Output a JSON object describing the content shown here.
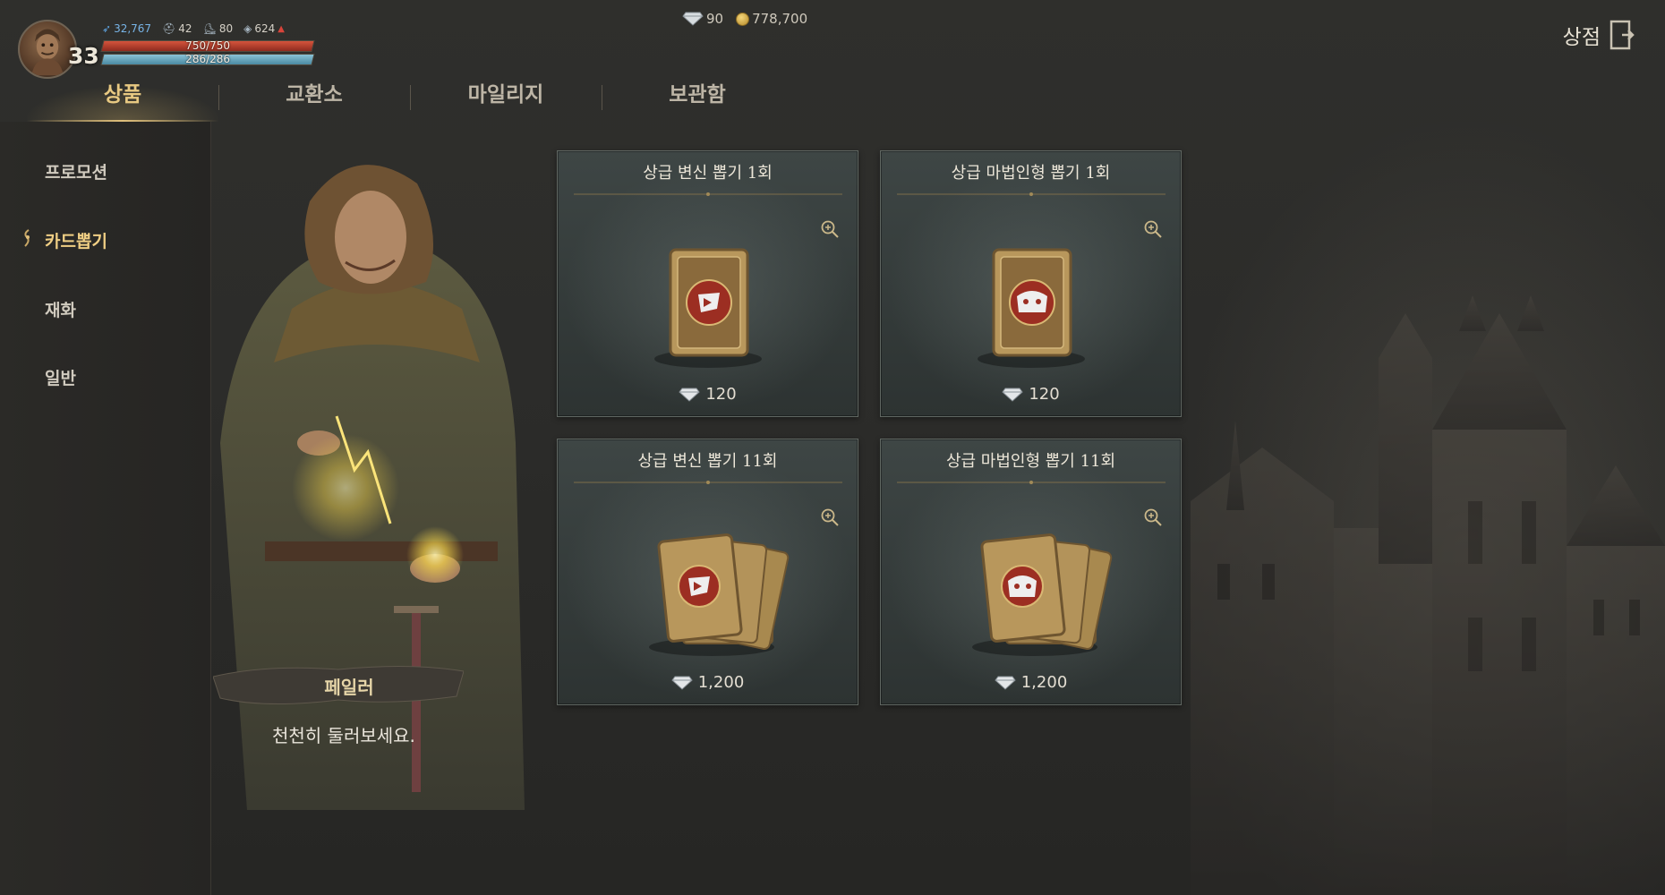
{
  "hud": {
    "level": "33",
    "combat_power": "32,767",
    "stat_2": "42",
    "stat_3": "80",
    "stat_4": "624",
    "hp_text": "750/750",
    "hp_ratio": 1.0,
    "mp_text": "286/286",
    "mp_ratio": 1.0
  },
  "currency": {
    "diamonds": "90",
    "gold": "778,700"
  },
  "shop_title": "상점",
  "tabs": [
    {
      "label": "상품",
      "active": true
    },
    {
      "label": "교환소",
      "active": false
    },
    {
      "label": "마일리지",
      "active": false
    },
    {
      "label": "보관함",
      "active": false
    }
  ],
  "sidebar": {
    "items": [
      {
        "label": "프로모션",
        "active": false
      },
      {
        "label": "카드뽑기",
        "active": true
      },
      {
        "label": "재화",
        "active": false
      },
      {
        "label": "일반",
        "active": false
      }
    ]
  },
  "npc": {
    "name": "페일러",
    "dialog": "천천히 둘러보세요."
  },
  "products": [
    {
      "title": "상급 변신 뽑기 1회",
      "price": "120",
      "art": "transform-card-icon"
    },
    {
      "title": "상급 마법인형 뽑기 1회",
      "price": "120",
      "art": "doll-card-icon"
    },
    {
      "title": "상급 변신 뽑기 11회",
      "price": "1,200",
      "art": "transform-card-stack-icon"
    },
    {
      "title": "상급 마법인형 뽑기 11회",
      "price": "1,200",
      "art": "doll-card-stack-icon"
    }
  ],
  "colors": {
    "accent_gold": "#e8c982",
    "hp": "#c84a34",
    "mp": "#7ab7cc",
    "combat_power": "#78b4e6"
  }
}
